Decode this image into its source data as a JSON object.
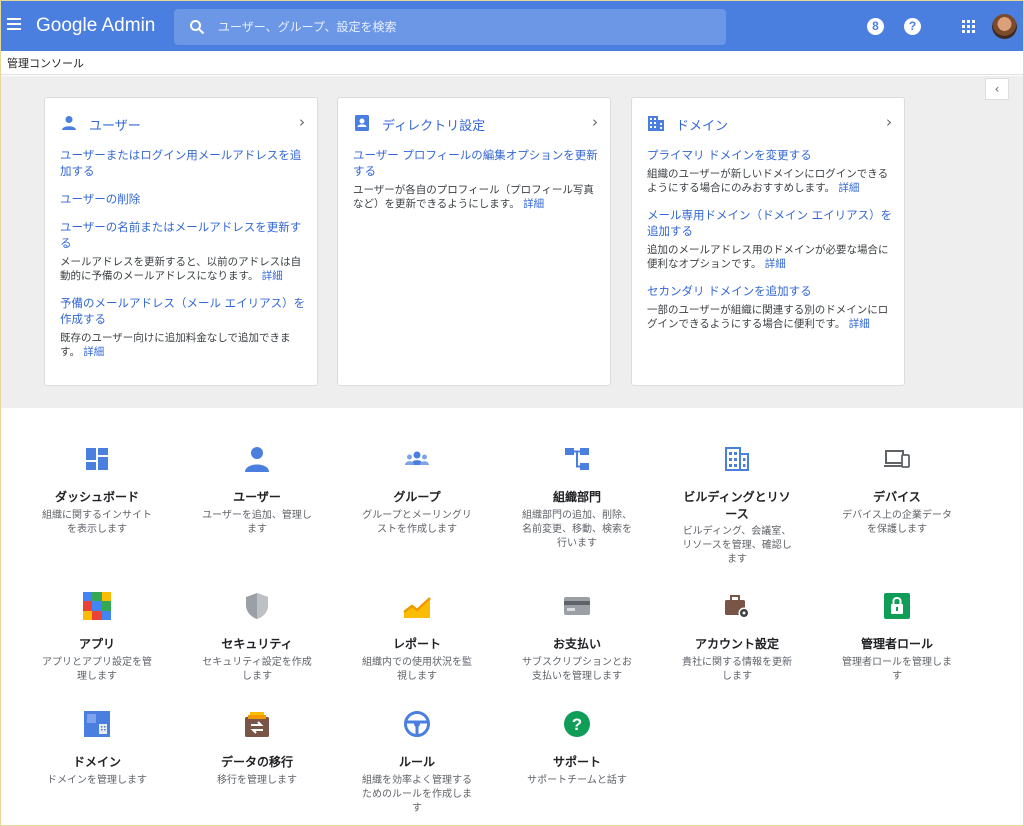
{
  "header": {
    "app_name": "Google Admin",
    "search_placeholder": "ユーザー、グループ、設定を検索",
    "help_label": "?",
    "support_label": "8"
  },
  "breadcrumb": {
    "title": "管理コンソール"
  },
  "cards": [
    {
      "title": "ユーザー",
      "items": [
        {
          "link": "ユーザーまたはログイン用メールアドレスを追加する",
          "desc": "",
          "more": ""
        },
        {
          "link": "ユーザーの削除",
          "desc": "",
          "more": ""
        },
        {
          "link": "ユーザーの名前またはメールアドレスを更新する",
          "desc": "メールアドレスを更新すると、以前のアドレスは自動的に予備のメールアドレスになります。",
          "more": "詳細"
        },
        {
          "link": "予備のメールアドレス（メール エイリアス）を作成する",
          "desc": "既存のユーザー向けに追加料金なしで追加できます。",
          "more": "詳細"
        }
      ]
    },
    {
      "title": "ディレクトリ設定",
      "items": [
        {
          "link": "ユーザー プロフィールの編集オプションを更新する",
          "desc": "ユーザーが各自のプロフィール（プロフィール写真など）を更新できるようにします。",
          "more": "詳細"
        }
      ]
    },
    {
      "title": "ドメイン",
      "items": [
        {
          "link": "プライマリ ドメインを変更する",
          "desc": "組織のユーザーが新しいドメインにログインできるようにする場合にのみおすすめします。",
          "more": "詳細"
        },
        {
          "link": "メール専用ドメイン（ドメイン エイリアス）を追加する",
          "desc": "追加のメールアドレス用のドメインが必要な場合に便利なオプションです。",
          "more": "詳細"
        },
        {
          "link": "セカンダリ ドメインを追加する",
          "desc": "一部のユーザーが組織に関連する別のドメインにログインできるようにする場合に便利です。",
          "more": "詳細"
        }
      ]
    }
  ],
  "tiles": [
    {
      "title": "ダッシュボード",
      "desc": "組織に関するインサイトを表示します",
      "icon": "dashboard-icon"
    },
    {
      "title": "ユーザー",
      "desc": "ユーザーを追加、管理します",
      "icon": "user-icon"
    },
    {
      "title": "グループ",
      "desc": "グループとメーリングリストを作成します",
      "icon": "groups-icon"
    },
    {
      "title": "組織部門",
      "desc": "組織部門の追加、削除、名前変更、移動、検索を行います",
      "icon": "org-units-icon"
    },
    {
      "title": "ビルディングとリソース",
      "desc": "ビルディング、会議室、リソースを管理、確認します",
      "icon": "building-icon"
    },
    {
      "title": "デバイス",
      "desc": "デバイス上の企業データを保護します",
      "icon": "devices-icon"
    },
    {
      "title": "アプリ",
      "desc": "アプリとアプリ設定を管理します",
      "icon": "apps-grid-icon"
    },
    {
      "title": "セキュリティ",
      "desc": "セキュリティ設定を作成します",
      "icon": "shield-icon"
    },
    {
      "title": "レポート",
      "desc": "組織内での使用状況を監視します",
      "icon": "reports-chart-icon"
    },
    {
      "title": "お支払い",
      "desc": "サブスクリプションとお支払いを管理します",
      "icon": "credit-card-icon"
    },
    {
      "title": "アカウント設定",
      "desc": "貴社に関する情報を更新します",
      "icon": "briefcase-gear-icon"
    },
    {
      "title": "管理者ロール",
      "desc": "管理者ロールを管理します",
      "icon": "lock-icon"
    },
    {
      "title": "ドメイン",
      "desc": "ドメインを管理します",
      "icon": "domain-icon"
    },
    {
      "title": "データの移行",
      "desc": "移行を管理します",
      "icon": "data-migration-icon"
    },
    {
      "title": "ルール",
      "desc": "組織を効率よく管理するためのルールを作成します",
      "icon": "steering-wheel-icon"
    },
    {
      "title": "サポート",
      "desc": "サポートチームと話す",
      "icon": "help-circle-icon"
    }
  ],
  "colors": {
    "header_bg": "#4a7fe0",
    "link": "#3367d6",
    "section_bg": "#eeeeee"
  }
}
